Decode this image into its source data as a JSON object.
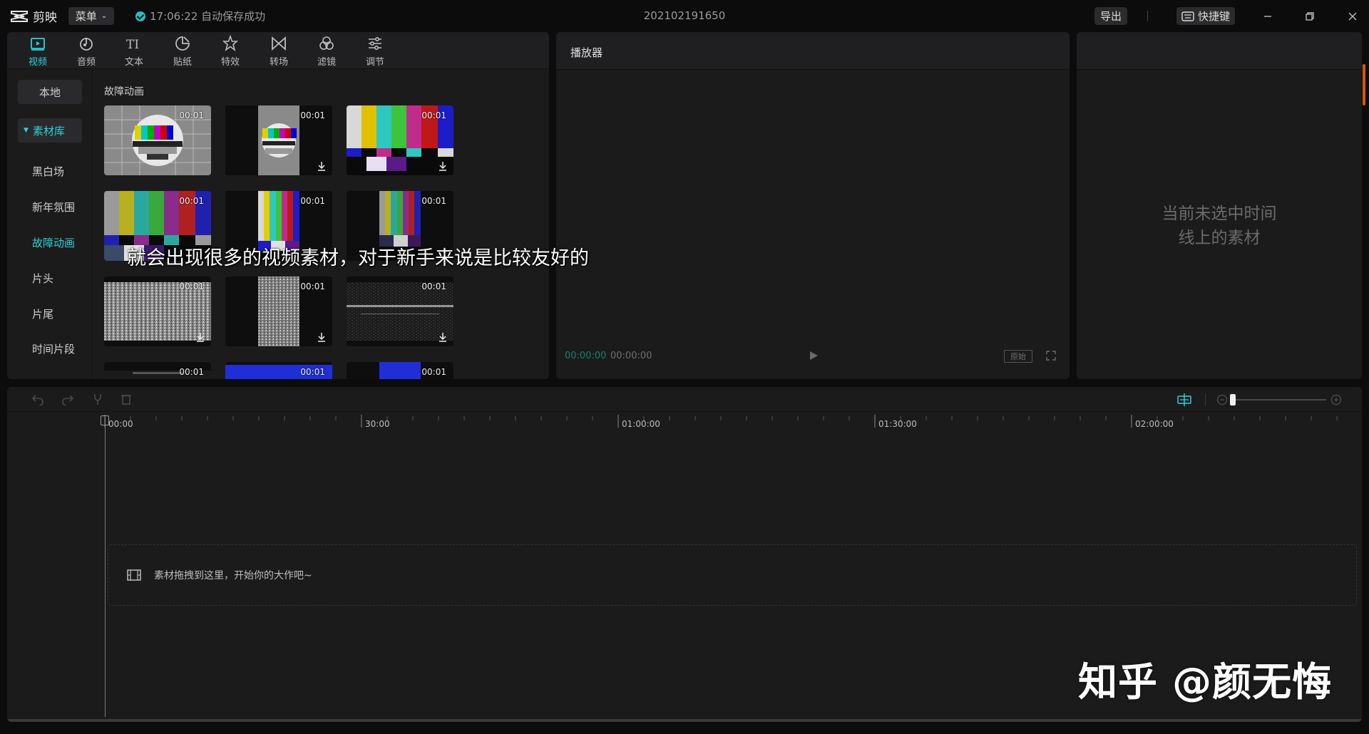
{
  "app": {
    "name": "剪映",
    "menu_label": "菜单",
    "save_status": "17:06:22 自动保存成功",
    "project_name": "202102191650",
    "export_label": "导出",
    "shortcut_label": "快捷键",
    "accent_color": "#2fd0d6"
  },
  "toolbar": {
    "tabs": [
      {
        "label": "视频",
        "icon": "video-icon",
        "active": true
      },
      {
        "label": "音频",
        "icon": "audio-icon",
        "active": false
      },
      {
        "label": "文本",
        "icon": "text-icon",
        "active": false
      },
      {
        "label": "贴纸",
        "icon": "sticker-icon",
        "active": false
      },
      {
        "label": "特效",
        "icon": "effects-icon",
        "active": false
      },
      {
        "label": "转场",
        "icon": "transition-icon",
        "active": false
      },
      {
        "label": "滤镜",
        "icon": "filter-icon",
        "active": false
      },
      {
        "label": "调节",
        "icon": "adjust-icon",
        "active": false
      }
    ]
  },
  "sidebar": {
    "local": "本地",
    "library": "素材库",
    "items": [
      "黑白场",
      "新年氛围",
      "故障动画",
      "片头",
      "片尾",
      "时间片段"
    ],
    "current": "故障动画"
  },
  "media": {
    "section_title": "故障动画",
    "clips": [
      {
        "duration": "00:01",
        "style": "test-card"
      },
      {
        "duration": "00:01",
        "style": "test-card-narrow"
      },
      {
        "duration": "00:01",
        "style": "color-bars"
      },
      {
        "duration": "00:01",
        "style": "color-bars"
      },
      {
        "duration": "00:01",
        "style": "color-bars-narrow"
      },
      {
        "duration": "00:01",
        "style": "color-bars-narrow-2"
      },
      {
        "duration": "00:01",
        "style": "static-noise"
      },
      {
        "duration": "00:01",
        "style": "static-noise-narrow"
      },
      {
        "duration": "00:01",
        "style": "dark-noise"
      },
      {
        "duration": "00:01",
        "style": "dark"
      },
      {
        "duration": "00:01",
        "style": "blue"
      },
      {
        "duration": "00:01",
        "style": "blue-narrow"
      }
    ]
  },
  "player": {
    "title": "播放器",
    "current_time": "00:00:00",
    "total_time": "00:00:00",
    "ratio_label": "原始"
  },
  "detail": {
    "empty_line1": "当前未选中时间",
    "empty_line2": "线上的素材"
  },
  "timeline": {
    "ticks": [
      "00:00",
      "30:00",
      "01:00:00",
      "01:30:00",
      "02:00:00"
    ],
    "drop_hint": "素材拖拽到这里，开始你的大作吧~",
    "zoom_level": 0.05
  },
  "overlay": {
    "subtitle": "就会出现很多的视频素材，对于新手来说是比较友好的",
    "watermark": "知乎 @颜无悔"
  }
}
